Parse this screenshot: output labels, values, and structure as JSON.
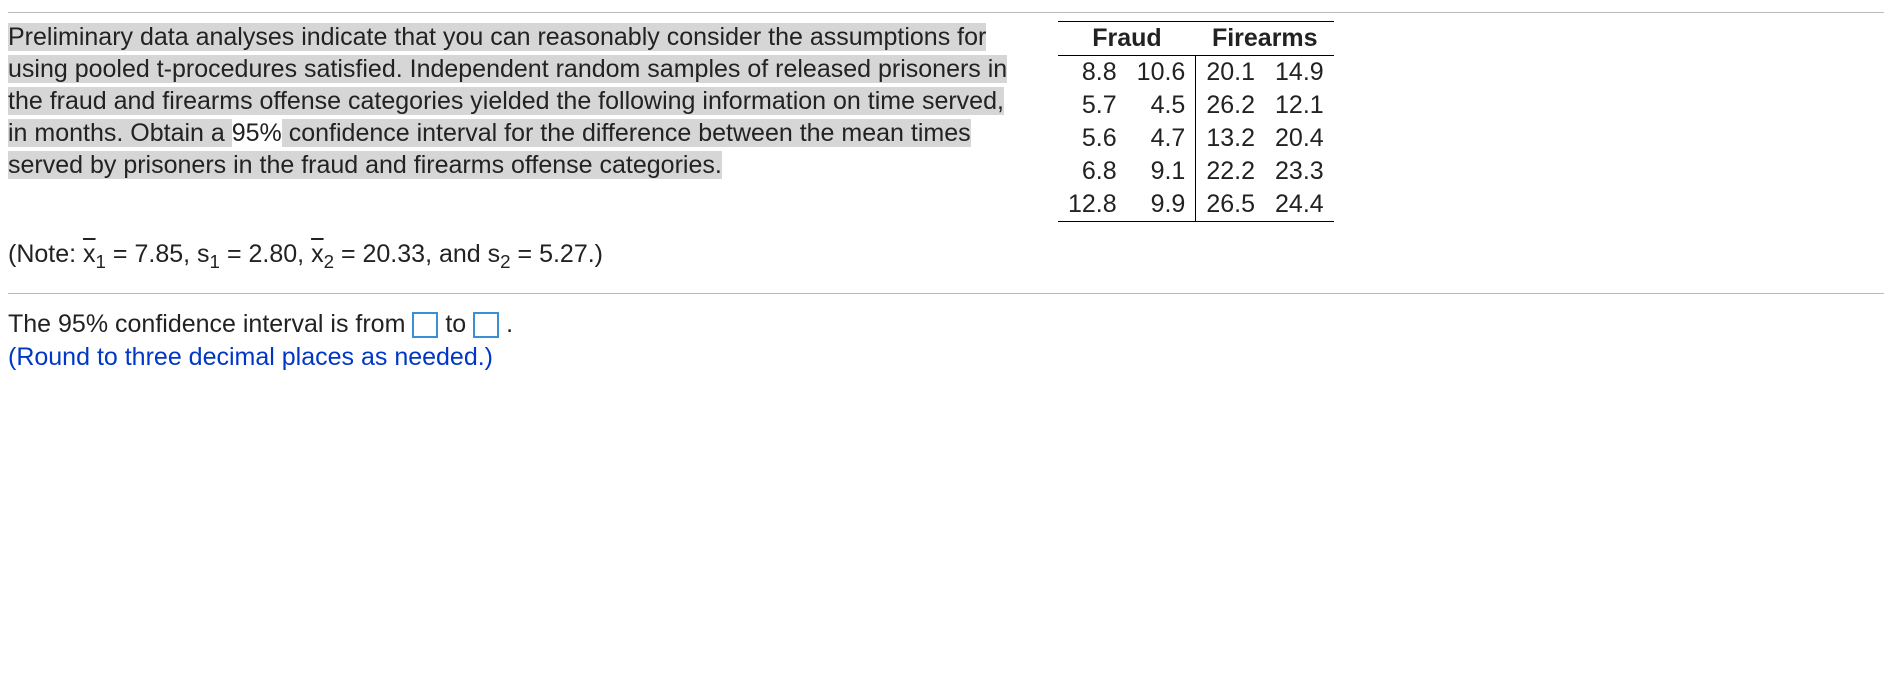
{
  "question": {
    "paragraph_pre": "Preliminary data analyses indicate that you can reasonably consider the assumptions for using pooled t-procedures satisfied. Independent random samples of released prisoners in the fraud and firearms offense categories yielded the following information on time served, in months. Obtain a ",
    "paragraph_unhighlighted": "95%",
    "paragraph_post": " confidence interval for the difference between the mean times served by prisoners in the fraud and firearms offense categories."
  },
  "table": {
    "headers": {
      "col1": "Fraud",
      "col2": "Firearms"
    },
    "rows": [
      {
        "f1": "8.8",
        "f2": "10.6",
        "g1": "20.1",
        "g2": "14.9"
      },
      {
        "f1": "5.7",
        "f2": "4.5",
        "g1": "26.2",
        "g2": "12.1"
      },
      {
        "f1": "5.6",
        "f2": "4.7",
        "g1": "13.2",
        "g2": "20.4"
      },
      {
        "f1": "6.8",
        "f2": "9.1",
        "g1": "22.2",
        "g2": "23.3"
      },
      {
        "f1": "12.8",
        "f2": "9.9",
        "g1": "26.5",
        "g2": "24.4"
      }
    ]
  },
  "note": {
    "prefix": "(Note: ",
    "xbar1_sym": "x",
    "xbar1_sub": "1",
    "xbar1_val": "7.85",
    "s1_sym": "s",
    "s1_sub": "1",
    "s1_val": "2.80",
    "xbar2_sym": "x",
    "xbar2_sub": "2",
    "xbar2_val": "20.33",
    "s2_sym": "s",
    "s2_sub": "2",
    "s2_val": "5.27",
    "eq": " = ",
    "comma": ", ",
    "and": ", and ",
    "suffix": ".)"
  },
  "answer": {
    "prefix": "The 95% confidence interval is from ",
    "mid": " to ",
    "suffix": ".",
    "hint": "(Round to three decimal places as needed.)"
  },
  "chart_data": {
    "type": "table",
    "title": "Time served in months by offense category",
    "series": [
      {
        "name": "Fraud",
        "values": [
          8.8,
          10.6,
          5.7,
          4.5,
          5.6,
          4.7,
          6.8,
          9.1,
          12.8,
          9.9
        ]
      },
      {
        "name": "Firearms",
        "values": [
          20.1,
          14.9,
          26.2,
          12.1,
          13.2,
          20.4,
          22.2,
          23.3,
          26.5,
          24.4
        ]
      }
    ],
    "summary": {
      "xbar1": 7.85,
      "s1": 2.8,
      "xbar2": 20.33,
      "s2": 5.27
    }
  }
}
